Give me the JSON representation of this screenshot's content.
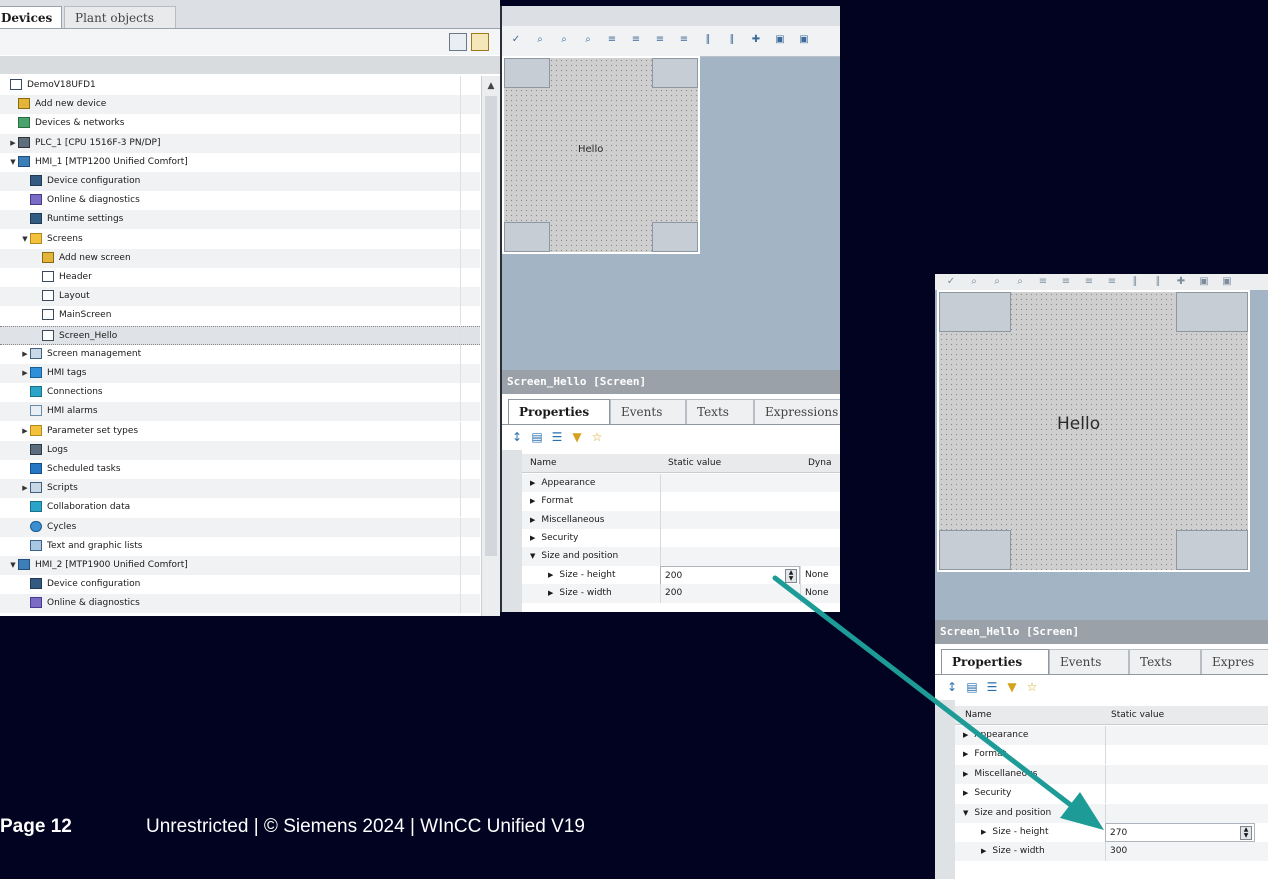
{
  "tree": {
    "tabs": [
      "Devices",
      "Plant objects"
    ],
    "items": [
      {
        "label": "DemoV18UFD1",
        "icon": "project-icon",
        "indent": 0,
        "arrow": ""
      },
      {
        "label": "Add new device",
        "icon": "add-device-icon",
        "indent": 1,
        "arrow": ""
      },
      {
        "label": "Devices & networks",
        "icon": "network-icon",
        "indent": 1,
        "arrow": ""
      },
      {
        "label": "PLC_1 [CPU 1516F-3 PN/DP]",
        "icon": "plc-icon",
        "indent": 1,
        "arrow": "right"
      },
      {
        "label": "HMI_1 [MTP1200 Unified Comfort]",
        "icon": "hmi-icon",
        "indent": 1,
        "arrow": "down"
      },
      {
        "label": "Device configuration",
        "icon": "device-config-icon",
        "indent": 2,
        "arrow": ""
      },
      {
        "label": "Online & diagnostics",
        "icon": "diagnostics-icon",
        "indent": 2,
        "arrow": ""
      },
      {
        "label": "Runtime settings",
        "icon": "runtime-settings-icon",
        "indent": 2,
        "arrow": ""
      },
      {
        "label": "Screens",
        "icon": "folder-icon",
        "indent": 2,
        "arrow": "down"
      },
      {
        "label": "Add new screen",
        "icon": "add-screen-icon",
        "indent": 3,
        "arrow": ""
      },
      {
        "label": "Header",
        "icon": "screen-icon",
        "indent": 3,
        "arrow": ""
      },
      {
        "label": "Layout",
        "icon": "screen-icon",
        "indent": 3,
        "arrow": ""
      },
      {
        "label": "MainScreen",
        "icon": "screen-icon",
        "indent": 3,
        "arrow": ""
      },
      {
        "label": "Screen_Hello",
        "icon": "screen-icon",
        "indent": 3,
        "arrow": "",
        "selected": true
      },
      {
        "label": "Screen management",
        "icon": "screen-management-icon",
        "indent": 2,
        "arrow": "right"
      },
      {
        "label": "HMI tags",
        "icon": "hmi-tags-icon",
        "indent": 2,
        "arrow": "right"
      },
      {
        "label": "Connections",
        "icon": "connections-icon",
        "indent": 2,
        "arrow": ""
      },
      {
        "label": "HMI alarms",
        "icon": "hmi-alarms-icon",
        "indent": 2,
        "arrow": ""
      },
      {
        "label": "Parameter set types",
        "icon": "folder-icon",
        "indent": 2,
        "arrow": "right"
      },
      {
        "label": "Logs",
        "icon": "logs-icon",
        "indent": 2,
        "arrow": ""
      },
      {
        "label": "Scheduled tasks",
        "icon": "scheduled-tasks-icon",
        "indent": 2,
        "arrow": ""
      },
      {
        "label": "Scripts",
        "icon": "scripts-icon",
        "indent": 2,
        "arrow": "right"
      },
      {
        "label": "Collaboration data",
        "icon": "collaboration-icon",
        "indent": 2,
        "arrow": ""
      },
      {
        "label": "Cycles",
        "icon": "cycles-icon",
        "indent": 2,
        "arrow": ""
      },
      {
        "label": "Text and graphic lists",
        "icon": "text-lists-icon",
        "indent": 2,
        "arrow": ""
      },
      {
        "label": "HMI_2 [MTP1900 Unified Comfort]",
        "icon": "hmi-icon",
        "indent": 1,
        "arrow": "down"
      },
      {
        "label": "Device configuration",
        "icon": "device-config-icon",
        "indent": 2,
        "arrow": ""
      },
      {
        "label": "Online & diagnostics",
        "icon": "diagnostics-icon",
        "indent": 2,
        "arrow": ""
      }
    ]
  },
  "editor": {
    "canvas_text": "Hello"
  },
  "properties": {
    "title": "Screen_Hello [Screen]",
    "tabs": [
      "Properties",
      "Events",
      "Texts",
      "Expressions"
    ],
    "tabs_zoom": [
      "Properties",
      "Events",
      "Texts",
      "Expres"
    ],
    "columns": {
      "name": "Name",
      "static": "Static value",
      "dynamic": "Dyna"
    },
    "groups": [
      "Appearance",
      "Format",
      "Miscellaneous",
      "Security",
      "Size and position"
    ],
    "size": {
      "height_label": "Size - height",
      "width_label": "Size - width",
      "before": {
        "height": "200",
        "width": "200",
        "dynamic": "None"
      },
      "after": {
        "height": "270",
        "width": "300"
      }
    }
  },
  "footer": {
    "page": "Page 12",
    "info": "Unrestricted | © Siemens 2024 | WInCC Unified V19"
  },
  "colors": {
    "background": "#020320",
    "canvas_area": "#a3b4c4",
    "arrow": "#1c9b97"
  }
}
